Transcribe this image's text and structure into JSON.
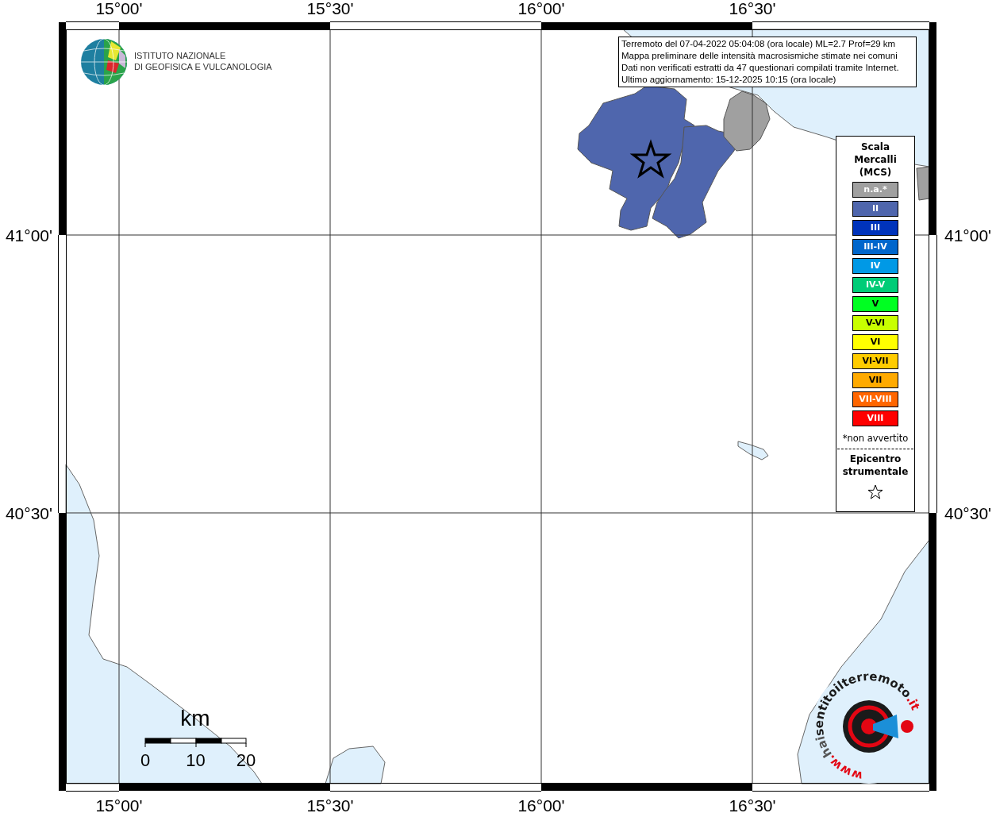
{
  "map": {
    "top_labels": [
      "15°00'",
      "15°30'",
      "16°00'",
      "16°30'"
    ],
    "bottom_labels": [
      "15°00'",
      "15°30'",
      "16°00'",
      "16°30'"
    ],
    "left_labels": [
      "41°00'",
      "40°30'"
    ],
    "right_labels": [
      "41°00'",
      "40°30'"
    ],
    "regions": [
      {
        "color": "#4f66ad"
      },
      {
        "color": "#4f66ad"
      },
      {
        "color": "#a0a0a0"
      },
      {
        "color": "#a0a0a0"
      }
    ]
  },
  "logo": {
    "lines": [
      "ISTITUTO NAZIONALE",
      "DI GEOFISICA E VULCANOLOGIA"
    ]
  },
  "info_box": {
    "lines": [
      "Terremoto del 07-04-2022 05:04:08 (ora locale) ML=2.7 Prof=29 km",
      "Mappa preliminare delle intensità macrosismiche stimate nei comuni",
      "Dati non verificati estratti da 47 questionari compilati tramite Internet.",
      "Ultimo aggiornamento: 15-12-2025 10:15 (ora locale)"
    ]
  },
  "legend": {
    "title_lines": [
      "Scala",
      "Mercalli",
      "(MCS)"
    ],
    "items": [
      {
        "label": "n.a.*",
        "color": "#a0a0a0"
      },
      {
        "label": "II",
        "color": "#4f66ad"
      },
      {
        "label": "III",
        "color": "#0033bb"
      },
      {
        "label": "III-IV",
        "color": "#0066cc"
      },
      {
        "label": "IV",
        "color": "#0099e6"
      },
      {
        "label": "IV-V",
        "color": "#00cc77"
      },
      {
        "label": "V",
        "color": "#00ff22"
      },
      {
        "label": "V-VI",
        "color": "#c8ff00"
      },
      {
        "label": "VI",
        "color": "#ffff00"
      },
      {
        "label": "VI-VII",
        "color": "#ffcc00"
      },
      {
        "label": "VII",
        "color": "#ffaa00"
      },
      {
        "label": "VII-VIII",
        "color": "#ff6600"
      },
      {
        "label": "VIII",
        "color": "#ff0000"
      }
    ],
    "footnote": "*non avvertito",
    "epicenter_lines": [
      "Epicentro",
      "strumentale"
    ]
  },
  "scale_bar": {
    "unit": "km",
    "ticks": [
      "0",
      "10",
      "20"
    ]
  },
  "badge": {
    "parts": [
      {
        "text": "www.",
        "color": "#e30613"
      },
      {
        "text": "hai",
        "color": "#555555"
      },
      {
        "text": "sentitoilterremoto",
        "color": "#1a1a1a"
      },
      {
        "text": ".it",
        "color": "#e30613"
      }
    ]
  }
}
